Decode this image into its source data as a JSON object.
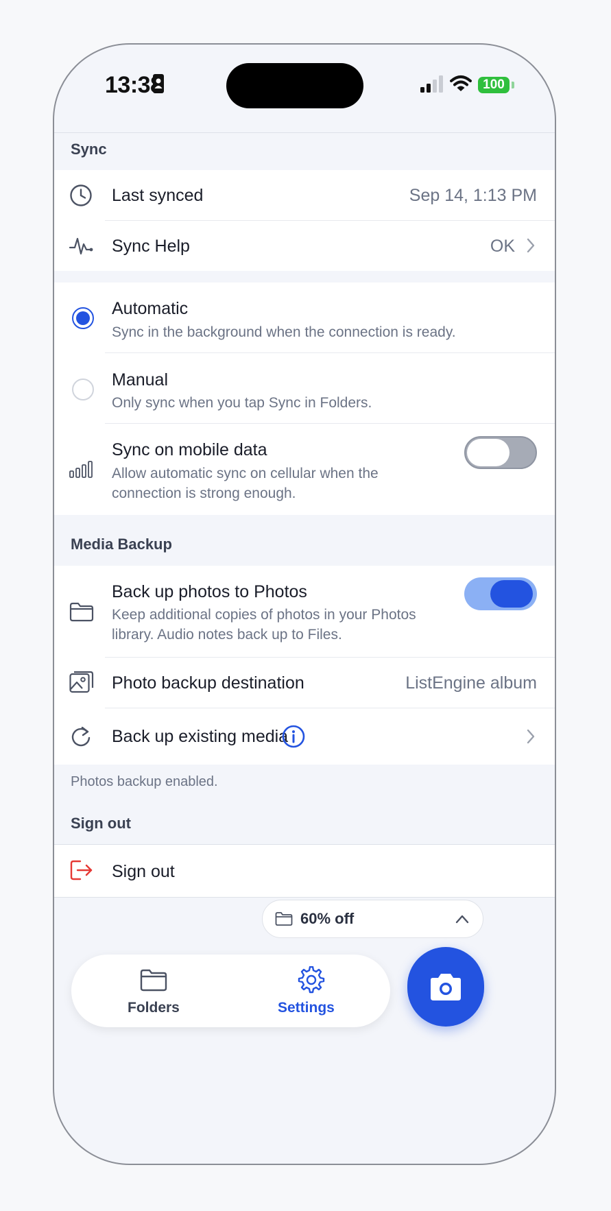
{
  "status_bar": {
    "time": "13:38",
    "battery": "100"
  },
  "sync_section": {
    "header": "Sync",
    "last_synced": {
      "label": "Last synced",
      "value": "Sep 14, 1:13 PM"
    },
    "sync_help": {
      "label": "Sync Help",
      "value": "OK"
    },
    "automatic": {
      "label": "Automatic",
      "description": "Sync in the background when the connection is ready.",
      "selected": true
    },
    "manual": {
      "label": "Manual",
      "description": "Only sync when you tap Sync in Folders.",
      "selected": false
    },
    "mobile_data": {
      "label": "Sync on mobile data",
      "description_line1": "Allow automatic sync on cellular when the",
      "description_line2": "connection is strong enough.",
      "enabled": false
    }
  },
  "media_section": {
    "header": "Media Backup",
    "backup_photos": {
      "label": "Back up photos to Photos",
      "description_line1": "Keep additional copies of photos in your Photos",
      "description_line2": "library. Audio notes back up to Files.",
      "enabled": true
    },
    "destination": {
      "label": "Photo backup destination",
      "value": "ListEngine album"
    },
    "existing_media": {
      "label": "Back up existing media"
    },
    "footer": "Photos backup enabled."
  },
  "signout_section": {
    "header": "Sign out",
    "signout": {
      "label": "Sign out"
    }
  },
  "promo": {
    "label": "60% off"
  },
  "tabbar": {
    "folders": "Folders",
    "settings": "Settings",
    "active": "settings"
  },
  "colors": {
    "accent": "#2353e0",
    "toggle_on_track": "#8bb0f4",
    "destructive": "#e53935",
    "battery": "#2fbf3d"
  }
}
